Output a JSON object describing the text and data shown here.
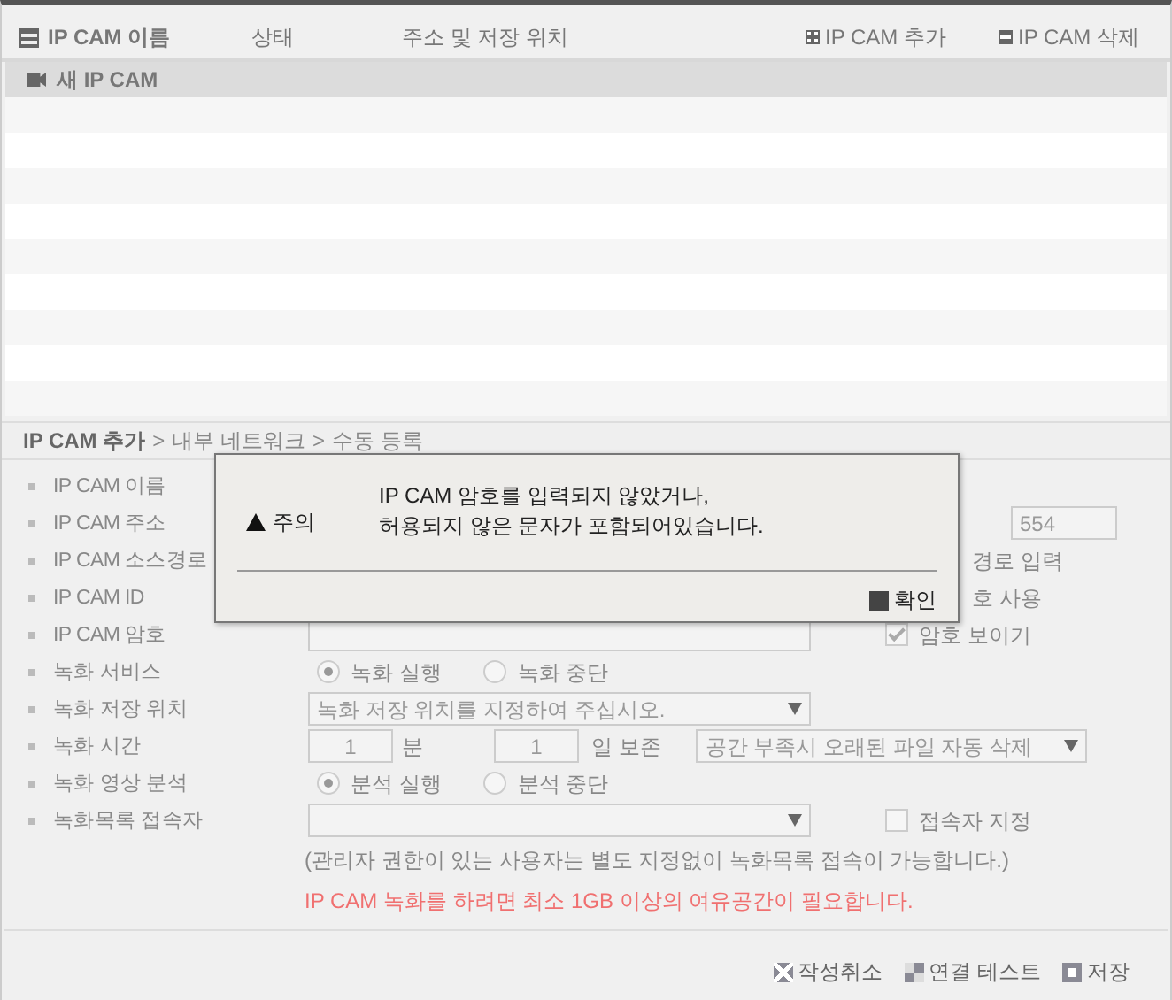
{
  "header": {
    "columns": [
      {
        "label": "IP CAM 이름",
        "kind": "name"
      },
      {
        "label": "상태",
        "kind": "status"
      },
      {
        "label": "주소 및 저장 위치",
        "kind": "address"
      }
    ],
    "actions": [
      {
        "label": "IP CAM 추가",
        "kind": "add"
      },
      {
        "label": "IP CAM 삭제",
        "kind": "delete"
      }
    ]
  },
  "cameras": [
    {
      "name": "새 IP CAM",
      "selected": true
    }
  ],
  "breadcrumb": {
    "items": [
      "IP CAM 추가",
      "내부 네트워크",
      "수동 등록"
    ],
    "separator": ">"
  },
  "form": [
    {
      "kind": "plain",
      "label": "IP CAM 이름"
    },
    {
      "kind": "port",
      "label": "IP CAM 주소",
      "value": "554"
    },
    {
      "kind": "side_text",
      "label": "IP CAM 소스경로",
      "text": "경로 입력"
    },
    {
      "kind": "side_text",
      "label": "IP CAM ID",
      "text": "호 사용"
    },
    {
      "kind": "password",
      "label": "IP CAM 암호",
      "check_label": "암호 보이기",
      "checked": true
    },
    {
      "kind": "radio",
      "label": "녹화 서비스",
      "options": [
        {
          "label": "녹화 실행",
          "selected": true
        },
        {
          "label": "녹화 중단",
          "selected": false
        }
      ]
    },
    {
      "kind": "select",
      "label": "녹화 저장 위치",
      "value": "녹화 저장 위치를 지정하여 주십시오."
    },
    {
      "kind": "time",
      "label": "녹화 시간",
      "minutes": "1",
      "minutes_unit": "분",
      "days": "1",
      "days_unit": "일 보존",
      "policy": "공간 부족시 오래된 파일 자동 삭제"
    },
    {
      "kind": "radio",
      "label": "녹화 영상 분석",
      "options": [
        {
          "label": "분석 실행",
          "selected": true
        },
        {
          "label": "분석 중단",
          "selected": false
        }
      ]
    },
    {
      "kind": "select_check",
      "label": "녹화목록 접속자",
      "check_label": "접속자 지정",
      "checked": false
    }
  ],
  "note": "(관리자 권한이 있는 사용자는 별도 지정없이 녹화목록 접속이 가능합니다.)",
  "warning": "IP CAM 녹화를 하려면 최소 1GB 이상의 여유공간이 필요합니다.",
  "dialog": {
    "title": "주의",
    "message": [
      "IP CAM 암호를 입력되지 않았거나,",
      "허용되지 않은 문자가 포함되어있습니다."
    ],
    "button": "확인"
  },
  "footer_buttons": [
    {
      "label": "작성취소",
      "kind": "cancel"
    },
    {
      "label": "연결 테스트",
      "kind": "test"
    },
    {
      "label": "저장",
      "kind": "save"
    }
  ]
}
